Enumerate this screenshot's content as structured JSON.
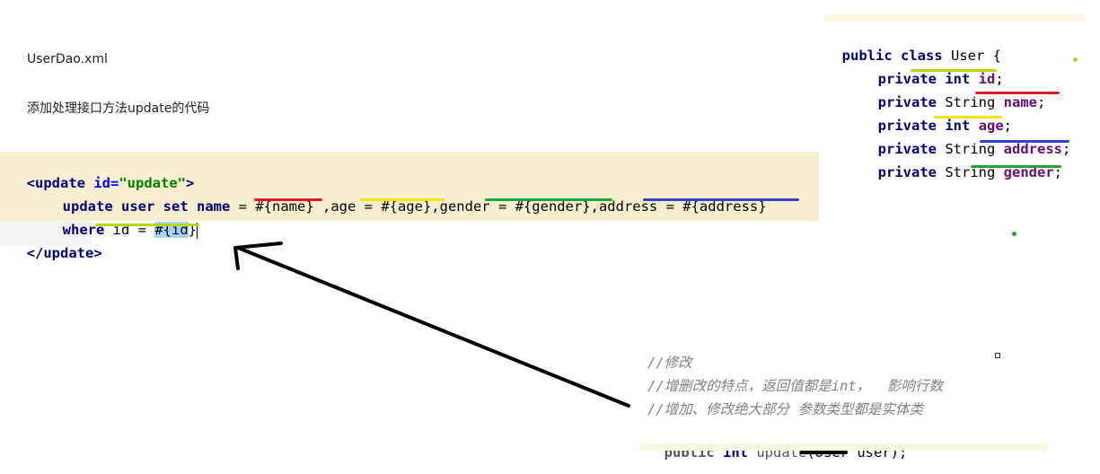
{
  "doc": {
    "title": "UserDao.xml",
    "description": "添加处理接口方法update的代码"
  },
  "xml": {
    "open_tag_start": "<update",
    "attr_name": " id",
    "attr_eq": "=",
    "attr_value": "\"update\"",
    "open_tag_end": ">",
    "kw_update": "update",
    "kw_user": " user",
    "kw_set": " set",
    "kw_name": " name",
    "set_clause": " = #{name} ,age = #{age},gender = #{gender},address = #{address}",
    "kw_where": "where",
    "where_rest": " id = ",
    "where_param_prefix": "#{id",
    "where_param_suffix": "}",
    "close_tag": "</update>"
  },
  "java_class": {
    "kw_public": "public",
    "kw_class": " class",
    "class_rest": " User {",
    "fields": [
      {
        "mod": "private",
        "type": " int",
        "type_is_kw": true,
        "name": " id",
        "end": ";"
      },
      {
        "mod": "private",
        "type": " String",
        "type_is_kw": false,
        "name": " name",
        "end": ";"
      },
      {
        "mod": "private",
        "type": " int",
        "type_is_kw": true,
        "name": " age",
        "end": ";"
      },
      {
        "mod": "private",
        "type": " String",
        "type_is_kw": false,
        "name": " address",
        "end": ";"
      },
      {
        "mod": "private",
        "type": " String",
        "type_is_kw": false,
        "name": " gender",
        "end": ";"
      }
    ]
  },
  "interface_method": {
    "comment1": "//修改",
    "comment2": "//增删改的特点，返回值都是int，  影响行数",
    "comment3": "//增加、修改绝大部分 参数类型都是实体类",
    "kw_public": "public",
    "kw_int": " int",
    "method_name": " update",
    "params": "(User user);"
  },
  "colors": {
    "red": "#e01b24",
    "yellow": "#f5e400",
    "green": "#22a33a",
    "blue": "#3340c8",
    "lime": "#b4d817",
    "black": "#000000"
  }
}
